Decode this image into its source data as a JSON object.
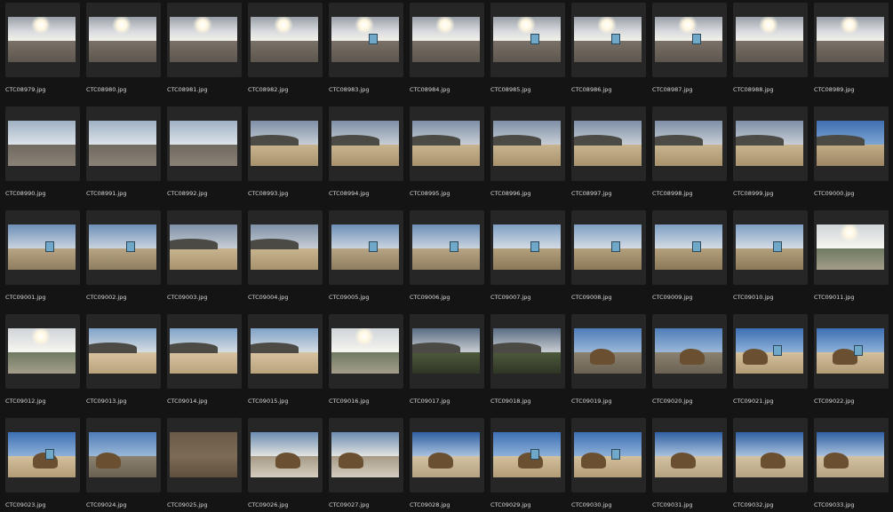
{
  "browser": {
    "files": [
      {
        "name": "CTC08979.jpg",
        "scene": "sun"
      },
      {
        "name": "CTC08980.jpg",
        "scene": "sun"
      },
      {
        "name": "CTC08981.jpg",
        "scene": "sun"
      },
      {
        "name": "CTC08982.jpg",
        "scene": "sun"
      },
      {
        "name": "CTC08983.jpg",
        "scene": "sun-tower"
      },
      {
        "name": "CTC08984.jpg",
        "scene": "sun"
      },
      {
        "name": "CTC08985.jpg",
        "scene": "sun-tower"
      },
      {
        "name": "CTC08986.jpg",
        "scene": "sun-tower"
      },
      {
        "name": "CTC08987.jpg",
        "scene": "sun-tower"
      },
      {
        "name": "CTC08988.jpg",
        "scene": "sun"
      },
      {
        "name": "CTC08989.jpg",
        "scene": "sun"
      },
      {
        "name": "CTC08990.jpg",
        "scene": "haze"
      },
      {
        "name": "CTC08991.jpg",
        "scene": "haze"
      },
      {
        "name": "CTC08992.jpg",
        "scene": "haze"
      },
      {
        "name": "CTC08993.jpg",
        "scene": "dune"
      },
      {
        "name": "CTC08994.jpg",
        "scene": "dune"
      },
      {
        "name": "CTC08995.jpg",
        "scene": "dune"
      },
      {
        "name": "CTC08996.jpg",
        "scene": "dune"
      },
      {
        "name": "CTC08997.jpg",
        "scene": "dune"
      },
      {
        "name": "CTC08998.jpg",
        "scene": "dune"
      },
      {
        "name": "CTC08999.jpg",
        "scene": "dune"
      },
      {
        "name": "CTC09000.jpg",
        "scene": "blue-hill"
      },
      {
        "name": "CTC09001.jpg",
        "scene": "tower-near"
      },
      {
        "name": "CTC09002.jpg",
        "scene": "tower-near"
      },
      {
        "name": "CTC09003.jpg",
        "scene": "dune"
      },
      {
        "name": "CTC09004.jpg",
        "scene": "dune"
      },
      {
        "name": "CTC09005.jpg",
        "scene": "tower-near"
      },
      {
        "name": "CTC09006.jpg",
        "scene": "tower-near"
      },
      {
        "name": "CTC09007.jpg",
        "scene": "tower-far"
      },
      {
        "name": "CTC09008.jpg",
        "scene": "tower-far"
      },
      {
        "name": "CTC09009.jpg",
        "scene": "tower-far"
      },
      {
        "name": "CTC09010.jpg",
        "scene": "tower-far"
      },
      {
        "name": "CTC09011.jpg",
        "scene": "bright"
      },
      {
        "name": "CTC09012.jpg",
        "scene": "bright"
      },
      {
        "name": "CTC09013.jpg",
        "scene": "mountain"
      },
      {
        "name": "CTC09014.jpg",
        "scene": "mountain"
      },
      {
        "name": "CTC09015.jpg",
        "scene": "mountain"
      },
      {
        "name": "CTC09016.jpg",
        "scene": "bright"
      },
      {
        "name": "CTC09017.jpg",
        "scene": "mountain-dark"
      },
      {
        "name": "CTC09018.jpg",
        "scene": "mountain-dark"
      },
      {
        "name": "CTC09019.jpg",
        "scene": "cliff"
      },
      {
        "name": "CTC09020.jpg",
        "scene": "cliff"
      },
      {
        "name": "CTC09021.jpg",
        "scene": "cliff-tower"
      },
      {
        "name": "CTC09022.jpg",
        "scene": "cliff-tower"
      },
      {
        "name": "CTC09023.jpg",
        "scene": "cliff-tower"
      },
      {
        "name": "CTC09024.jpg",
        "scene": "cliff"
      },
      {
        "name": "CTC09025.jpg",
        "scene": "closeup"
      },
      {
        "name": "CTC09026.jpg",
        "scene": "rock-wet"
      },
      {
        "name": "CTC09027.jpg",
        "scene": "rock-wet"
      },
      {
        "name": "CTC09028.jpg",
        "scene": "rock-beach"
      },
      {
        "name": "CTC09029.jpg",
        "scene": "cliff-tower"
      },
      {
        "name": "CTC09030.jpg",
        "scene": "cliff-tower"
      },
      {
        "name": "CTC09031.jpg",
        "scene": "rock-beach"
      },
      {
        "name": "CTC09032.jpg",
        "scene": "rock-beach"
      },
      {
        "name": "CTC09033.jpg",
        "scene": "rock-beach"
      }
    ]
  }
}
